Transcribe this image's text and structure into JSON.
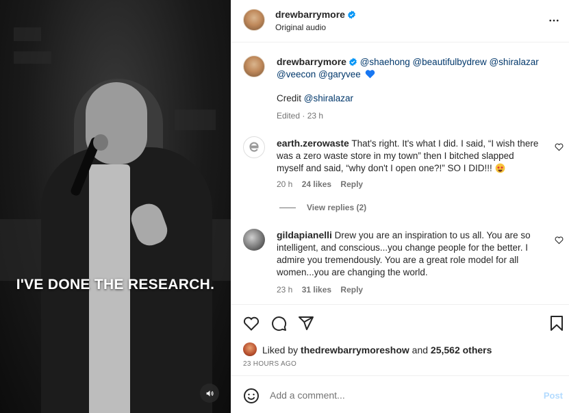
{
  "video": {
    "caption_text": "I'VE DONE THE RESEARCH.",
    "sound_icon": "speaker-icon"
  },
  "header": {
    "username": "drewbarrymore",
    "audio": "Original audio",
    "more_icon": "more-icon"
  },
  "post_caption": {
    "username": "drewbarrymore",
    "mentions_line1": "@shaehong @beautifulbydrew @shiralazar",
    "mentions_line2": "@veecon @garyvee",
    "credit_label": "Credit",
    "credit_mention": "@shiralazar",
    "meta": "Edited · 23 h"
  },
  "comments": [
    {
      "username": "earth.zerowaste",
      "lines": [
        "That's right. It's what I did. I said, “I wish there",
        "was a zero waste store in my town” then I bitched slapped",
        "myself and said, “why don't I open one?!” SO I DID!!!"
      ],
      "time": "20 h",
      "likes": "24 likes",
      "reply": "Reply",
      "view_replies": "View replies (2)"
    },
    {
      "username": "gildapianelli",
      "lines": [
        "Drew you are an inspiration to us all. You are so",
        "intelligent, and conscious...you change people for the better. I",
        "admire you tremendously. You are a great role model for all",
        "women...you are changing the world."
      ],
      "time": "23 h",
      "likes": "31 likes",
      "reply": "Reply"
    }
  ],
  "likes": {
    "prefix": "Liked by",
    "user": "thedrewbarrymoreshow",
    "and": "and",
    "others": "25,562 others"
  },
  "timestamp": "23 HOURS AGO",
  "add_comment": {
    "placeholder": "Add a comment...",
    "post_label": "Post"
  },
  "colors": {
    "verified": "#0095f6",
    "mention": "#00376b",
    "post_disabled": "#b3dbff"
  }
}
